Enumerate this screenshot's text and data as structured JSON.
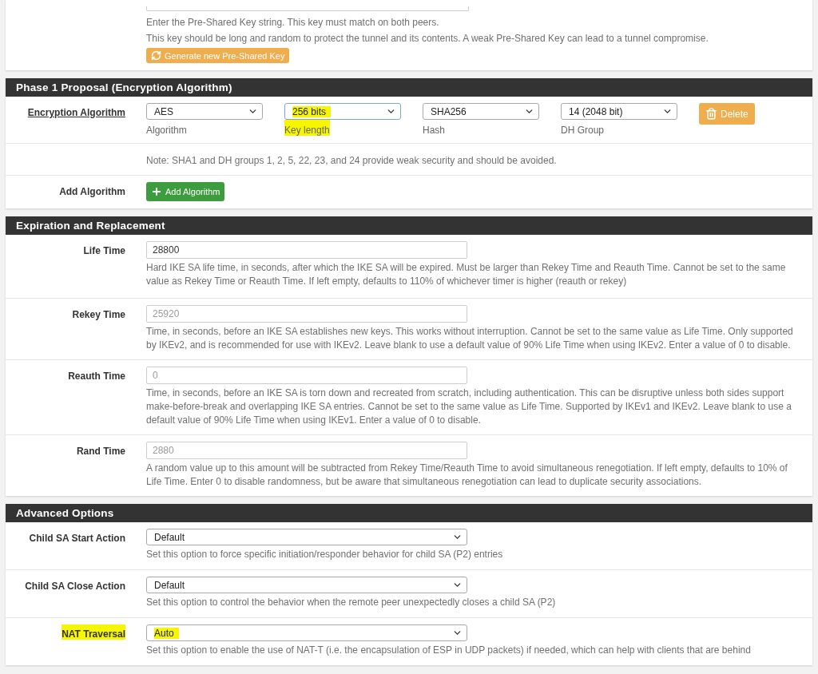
{
  "psk_panel": {
    "help": [
      "Enter the Pre-Shared Key string. This key must match on both peers.",
      "This key should be long and random to protect the tunnel and its contents. A weak Pre-Shared Key can lead to a tunnel compromise."
    ],
    "button": "Generate new Pre-Shared Key"
  },
  "phase1": {
    "title": "Phase 1 Proposal (Encryption Algorithm)",
    "label": "Encryption Algorithm",
    "selects": [
      {
        "value": "AES",
        "caption": "Algorithm",
        "highlighted": false
      },
      {
        "value": "256 bits",
        "caption": "Key length",
        "highlighted": true
      },
      {
        "value": "SHA256",
        "caption": "Hash",
        "highlighted": false
      },
      {
        "value": "14 (2048 bit)",
        "caption": "DH Group",
        "highlighted": false
      }
    ],
    "delete_button": "Delete",
    "note": "Note: SHA1 and DH groups 1, 2, 5, 22, 23, and 24 provide weak security and should be avoided.",
    "add_label": "Add Algorithm",
    "add_button": "Add Algorithm"
  },
  "expiration": {
    "title": "Expiration and Replacement",
    "rows": [
      {
        "label": "Life Time",
        "value": "28800",
        "help": "Hard IKE SA life time, in seconds, after which the IKE SA will be expired. Must be larger than Rekey Time and Reauth Time. Cannot be set to the same value as Rekey Time or Reauth Time. If left empty, defaults to 110% of whichever timer is higher (reauth or rekey)"
      },
      {
        "label": "Rekey Time",
        "placeholder": "25920",
        "help": "Time, in seconds, before an IKE SA establishes new keys. This works without interruption. Cannot be set to the same value as Life Time. Only supported by IKEv2, and is recommended for use with IKEv2. Leave blank to use a default value of 90% Life Time when using IKEv2. Enter a value of 0 to disable."
      },
      {
        "label": "Reauth Time",
        "placeholder": "0",
        "help": "Time, in seconds, before an IKE SA is torn down and recreated from scratch, including authentication. This can be disruptive unless both sides support make-before-break and overlapping IKE SA entries. Cannot be set to the same value as Life Time. Supported by IKEv1 and IKEv2. Leave blank to use a default value of 90% Life Time when using IKEv1. Enter a value of 0 to disable."
      },
      {
        "label": "Rand Time",
        "placeholder": "2880",
        "help": "A random value up to this amount will be subtracted from Rekey Time/Reauth Time to avoid simultaneous renegotiation. If left empty, defaults to 10% of Life Time. Enter 0 to disable randomness, but be aware that simultaneous renegotiation can lead to duplicate security associations."
      }
    ]
  },
  "advanced": {
    "title": "Advanced Options",
    "rows": [
      {
        "label": "Child SA Start Action",
        "value": "Default",
        "highlighted": false,
        "help": "Set this option to force specific initiation/responder behavior for child SA (P2) entries"
      },
      {
        "label": "Child SA Close Action",
        "value": "Default",
        "highlighted": false,
        "help": "Set this option to control the behavior when the remote peer unexpectedly closes a child SA (P2)"
      },
      {
        "label": "NAT Traversal",
        "value": "Auto",
        "highlighted": true,
        "help": "Set this option to enable the use of NAT-T (i.e. the encapsulation of ESP in UDP packets) if needed, which can help with clients that are behind"
      }
    ]
  }
}
